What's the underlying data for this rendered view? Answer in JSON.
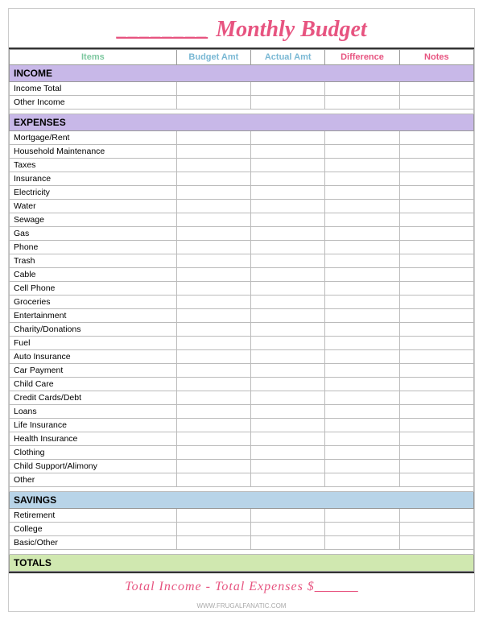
{
  "header": {
    "title": "Monthly Budget",
    "line": "________"
  },
  "columns": {
    "items": "Items",
    "budget_amt": "Budget Amt",
    "actual_amt": "Actual Amt",
    "difference": "Difference",
    "notes": "Notes"
  },
  "sections": {
    "income": {
      "label": "INCOME",
      "rows": [
        "Income Total",
        "Other Income"
      ]
    },
    "expenses": {
      "label": "EXPENSES",
      "rows": [
        "Mortgage/Rent",
        "Household Maintenance",
        "Taxes",
        "Insurance",
        "Electricity",
        "Water",
        "Sewage",
        "Gas",
        "Phone",
        "Trash",
        "Cable",
        "Cell Phone",
        "Groceries",
        "Entertainment",
        "Charity/Donations",
        "Fuel",
        "Auto Insurance",
        "Car Payment",
        "Child Care",
        "Credit Cards/Debt",
        "Loans",
        "Life Insurance",
        "Health Insurance",
        "Clothing",
        "Child Support/Alimony",
        "Other"
      ]
    },
    "savings": {
      "label": "SAVINGS",
      "rows": [
        "Retirement",
        "College",
        "Basic/Other"
      ]
    },
    "totals": {
      "label": "TOTALS"
    }
  },
  "footer": {
    "text": "Total Income - Total Expenses $",
    "line": "______"
  },
  "watermark": "WWW.FRUGALFANATIC.COM"
}
